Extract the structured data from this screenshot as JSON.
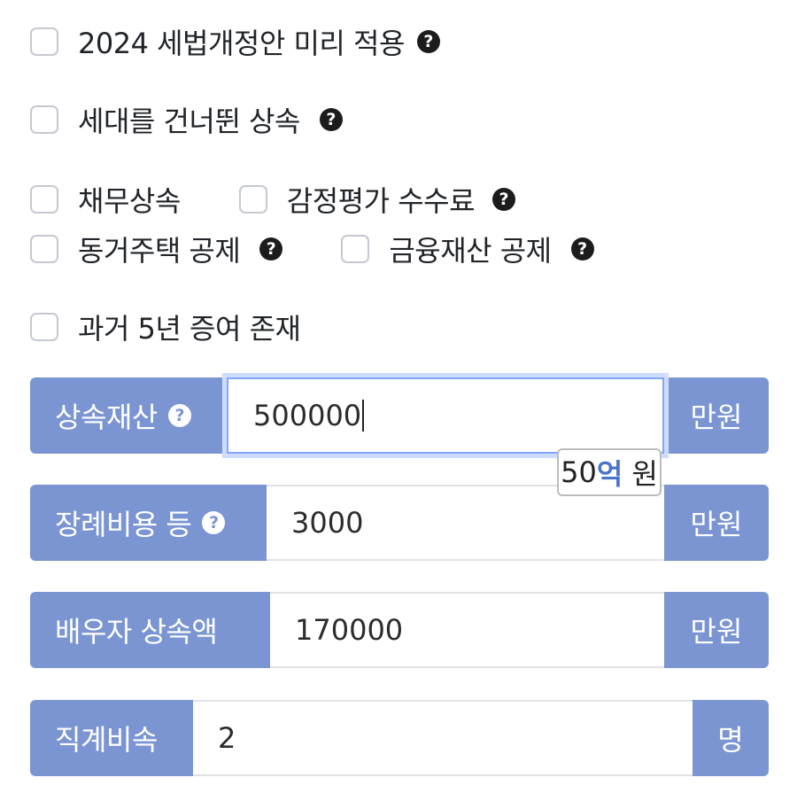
{
  "options": {
    "law2024": "2024 세법개정안 미리 적용",
    "generation_skip": "세대를 건너뛴 상속",
    "debt": "채무상속",
    "appraisal_fee": "감정평가 수수료",
    "cohabit_house": "동거주택 공제",
    "financial_asset": "금융재산 공제",
    "gift_5y": "과거 5년 증여 존재"
  },
  "help_glyph": "?",
  "fields": {
    "estate": {
      "label": "상속재산",
      "value": "500000",
      "unit": "만원"
    },
    "funeral": {
      "label": "장례비용 등",
      "value": "3000",
      "unit": "만원"
    },
    "spouse": {
      "label": "배우자 상속액",
      "value": "170000",
      "unit": "만원"
    },
    "children": {
      "label": "직계비속",
      "value": "2",
      "unit": "명"
    }
  },
  "tooltip": {
    "number": "50",
    "unit": "억",
    "suffix": " 원"
  },
  "colors": {
    "accent": "#7b95d2",
    "focus": "#80a6ff"
  }
}
